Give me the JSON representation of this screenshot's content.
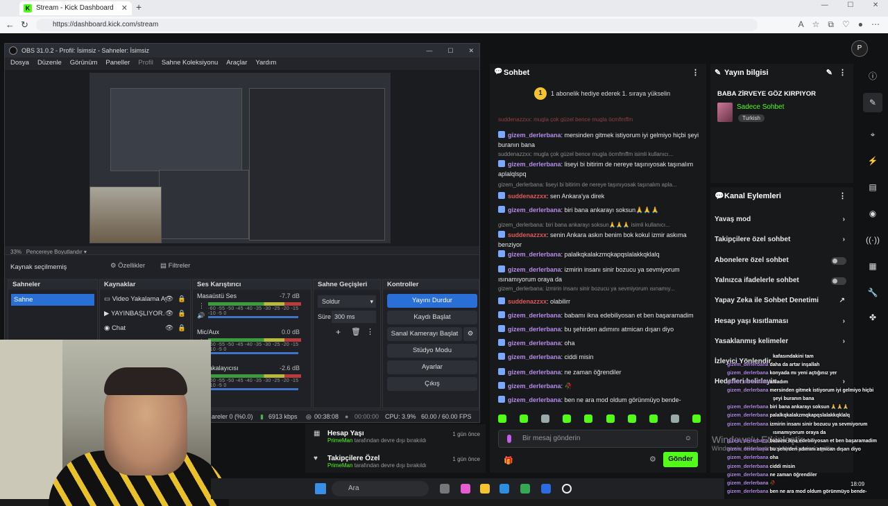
{
  "browser": {
    "tab_title": "Stream - Kick Dashboard",
    "url": "https://dashboard.kick.com/stream"
  },
  "obs": {
    "title": "OBS 31.0.2 - Profil: İsimsiz - Sahneler: İsimsiz",
    "menu": [
      "Dosya",
      "Düzenle",
      "Görünüm",
      "Paneller",
      "Profil",
      "Sahne Koleksiyonu",
      "Araçlar",
      "Yardım"
    ],
    "zoom": "33%",
    "preview_mode": "Pencereye Boyutlandır",
    "no_source": "Kaynak seçilmemiş",
    "properties": "Özellikler",
    "filters": "Filtreler",
    "scenes_title": "Sahneler",
    "scene": "Sahne",
    "sources_title": "Kaynaklar",
    "sources": [
      "Video Yakalama Ay",
      "YAYINBAŞLIYOR.m",
      "Chat"
    ],
    "mixer_title": "Ses Karıştırıcı",
    "mixer": [
      {
        "name": "Masaüstü Ses",
        "db": "-7.7 dB"
      },
      {
        "name": "Mic/Aux",
        "db": "0.0 dB"
      },
      {
        "name": "ris Yakalayıcısı",
        "db": "-2.6 dB"
      }
    ],
    "meter_scale": "-60 -55 -50 -45 -40 -35 -30 -25 -20 -15 -10 -5 0",
    "transitions_title": "Sahne Geçişleri",
    "transition": "Soldur",
    "duration_label": "Süre",
    "duration": "300 ms",
    "controls_title": "Kontroller",
    "controls": [
      "Yayını Durdur",
      "Kaydı Başlat",
      "Sanal Kamerayı Başlat",
      "Stüdyo Modu",
      "Ayarlar",
      "Çıkış"
    ],
    "status": {
      "frames": "areler 0 (%0.0)",
      "bitrate": "6913 kbps",
      "live": "00:38:08",
      "rec": "00:00:00",
      "cpu": "CPU: 3.9%",
      "fps": "60.00 / 60.00 FPS"
    }
  },
  "chat": {
    "title": "Sohbet",
    "gift_text": "1 abonelik hediye ederek 1. sıraya yükselin",
    "gift_count": "1",
    "top_cut": "suddenazzxx: mugla çok güzel bence mugla öcmfmffm",
    "messages": [
      {
        "user": "gizem_derlerbana",
        "text": ": mersinden gitmek istiyorum iyi gelmiyo hiçbi şeyi buranın bana",
        "color": "#b48ce8"
      },
      {
        "reply": "suddenazzxx: mugla çok güzel bence mugla öcmfmffm isimli kullanıcı..."
      },
      {
        "user": "gizem_derlerbana",
        "text": ": liseyi bi bitirim de nereye taşınıyosak taşınalım aplalqlspq",
        "color": "#b48ce8"
      },
      {
        "reply": "gizem_derlerbana: liseyi bi bitirim de nereye taşınıyosak taşınalım apla..."
      },
      {
        "user": "suddenazzxx",
        "text": ": sen Ankara'ya direk",
        "color": "#e05a5a"
      },
      {
        "user": "gizem_derlerbana",
        "text": ": biri bana ankarayı soksun🙏🙏🙏",
        "color": "#b48ce8"
      },
      {
        "reply": "gizem_derlerbana: biri bana ankarayı soksun🙏🙏🙏 isimli kullanıcı..."
      },
      {
        "user": "suddenazzxx",
        "text": ": senin Ankara askın benim bok kokul izmir askıma benziyor",
        "color": "#e05a5a"
      },
      {
        "user": "gizem_derlerbana",
        "text": ": palalkqkalakzmqkapqslalakkqklalq",
        "color": "#b48ce8"
      },
      {
        "user": "gizem_derlerbana",
        "text": ": izmirin insanı sinir bozucu ya sevmiyorum ısınamıyorum oraya da",
        "color": "#b48ce8"
      },
      {
        "reply": "gizem_derlerbana: izmirin insanı sinir bozucu ya sevmiyorum ısınamıy..."
      },
      {
        "user": "suddenazzxx",
        "text": ": olabilirr",
        "color": "#e05a5a"
      },
      {
        "user": "gizem_derlerbana",
        "text": ": babamı ikna edebiliyosan et ben başaramadim",
        "color": "#b48ce8"
      },
      {
        "user": "gizem_derlerbana",
        "text": ": bu şehirden adımını atmican dışarı diyo",
        "color": "#b48ce8"
      },
      {
        "user": "gizem_derlerbana",
        "text": ": oha",
        "color": "#b48ce8"
      },
      {
        "user": "gizem_derlerbana",
        "text": ": ciddi misin",
        "color": "#b48ce8"
      },
      {
        "user": "gizem_derlerbana",
        "text": ": ne zaman öğrendiler",
        "color": "#b48ce8"
      },
      {
        "user": "gizem_derlerbana",
        "text": ": 🥀",
        "color": "#b48ce8"
      },
      {
        "user": "gizem_derlerbana",
        "text": ": ben ne ara mod oldum görünmüyo bende-",
        "color": "#b48ce8"
      }
    ],
    "placeholder": "Bir mesaj gönderin",
    "send": "Gönder"
  },
  "info": {
    "title": "Yayın bilgisi",
    "stream_title": "BABA ZİRVEYE GÖZ KIRPIYOR",
    "category": "Sadece Sohbet",
    "language": "Turkish"
  },
  "actions": {
    "title": "Kanal Eylemleri",
    "items": [
      {
        "label": "Yavaş mod",
        "kind": "chevron"
      },
      {
        "label": "Takipçilere özel sohbet",
        "kind": "chevron"
      },
      {
        "label": "Abonelere özel sohbet",
        "kind": "toggle"
      },
      {
        "label": "Yalnızca ifadelerle sohbet",
        "kind": "toggle"
      },
      {
        "label": "Yapay Zeka ile Sohbet Denetimi",
        "kind": "external"
      },
      {
        "label": "Hesap yaşı kısıtlaması",
        "kind": "chevron"
      },
      {
        "label": "Yasaklanmış kelimeler",
        "kind": "chevron"
      },
      {
        "label": "İzleyici Yönlendir",
        "kind": "none"
      },
      {
        "label": "Hedefleri belirleyin",
        "kind": "chevron"
      }
    ]
  },
  "modlog": [
    {
      "title": "Hesap Yaşı",
      "by": "PrimeMan",
      "desc": "tarafından devre dışı bırakıldı",
      "when": "1 gün önce"
    },
    {
      "title": "Takipçilere Özel",
      "by": "PrimeMan",
      "desc": "tarafından devre dışı bırakıldı",
      "when": "1 gün önce"
    }
  ],
  "overlay": [
    {
      "u": "",
      "t": "kafasındakini tam"
    },
    {
      "u": "gizem_derlerbana",
      "t": "daha da artar inşallah"
    },
    {
      "u": "gizem_derlerbana",
      "t": "konyada mı yeni açtığınız yer"
    },
    {
      "u": "gizem_derlerbana",
      "t": "anladım"
    },
    {
      "u": "gizem_derlerbana",
      "t": "mersinden gitmek istiyorum iyi gelmiyo hiçbi"
    },
    {
      "u": "",
      "t": "şeyi buranın bana"
    },
    {
      "u": "gizem_derlerbana",
      "t": "biri bana ankarayı soksun 🙏🙏🙏"
    },
    {
      "u": "gizem_derlerbana",
      "t": "palalkqkalakzmqkapqslalakkqklalq"
    },
    {
      "u": "gizem_derlerbana",
      "t": "izmirin insanı sinir bozucu ya sevmiyorum"
    },
    {
      "u": "",
      "t": "ısınamıyorum oraya da"
    },
    {
      "u": "gizem_derlerbana",
      "t": "babamı ikna edebiliyosan et ben başaramadim"
    },
    {
      "u": "gizem_derlerbana",
      "t": "bu şehirden adımını atmican dışarı diyo"
    },
    {
      "u": "gizem_derlerbana",
      "t": "oha"
    },
    {
      "u": "gizem_derlerbana",
      "t": "ciddi misin"
    },
    {
      "u": "gizem_derlerbana",
      "t": "ne zaman öğrendiler"
    },
    {
      "u": "gizem_derlerbana",
      "t": "🥀"
    },
    {
      "u": "gizem_derlerbana",
      "t": "ben ne ara mod oldum görünmüyo bende-"
    }
  ],
  "taskbar": {
    "search": "Ara",
    "time": "18:09"
  },
  "watermark": {
    "line1": "Windows'u Etkinleştir",
    "line2": "Windows'u etkinleştirmek için Ayarlar'a gidin."
  },
  "colors": {
    "kick_green": "#53fc18",
    "obs_accent": "#2a6fd6"
  }
}
